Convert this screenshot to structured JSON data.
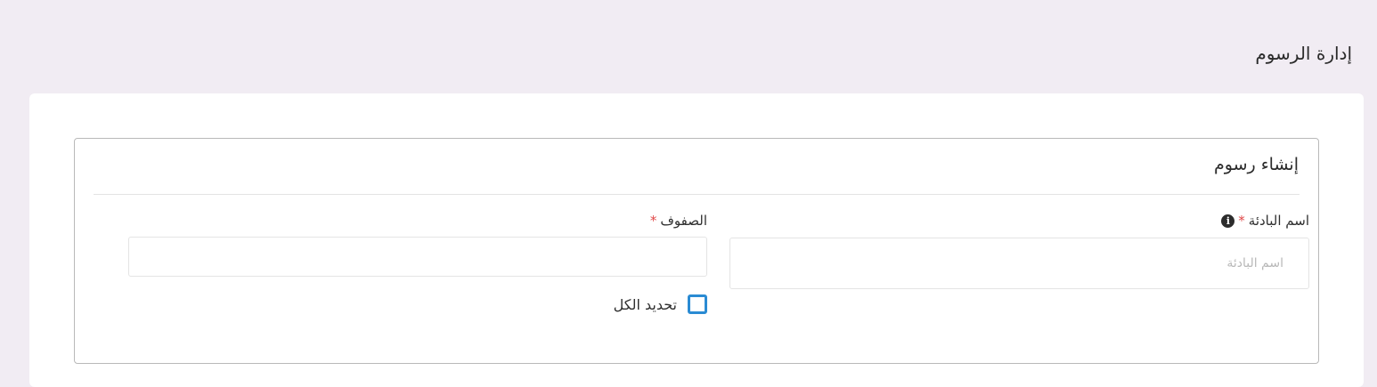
{
  "page": {
    "title": "إدارة الرسوم"
  },
  "form": {
    "title": "إنشاء رسوم",
    "prefix_field": {
      "label": "اسم البادئة",
      "required_mark": "*",
      "placeholder": "اسم البادئة",
      "value": ""
    },
    "rows_field": {
      "label": "الصفوف",
      "required_mark": "*",
      "value": ""
    },
    "select_all": {
      "label": "تحديد الكل",
      "checked": false
    }
  },
  "icons": {
    "info": "info-icon"
  },
  "colors": {
    "background": "#f1ecf3",
    "required": "#e04848",
    "checkbox_border": "#2a8bd3"
  }
}
